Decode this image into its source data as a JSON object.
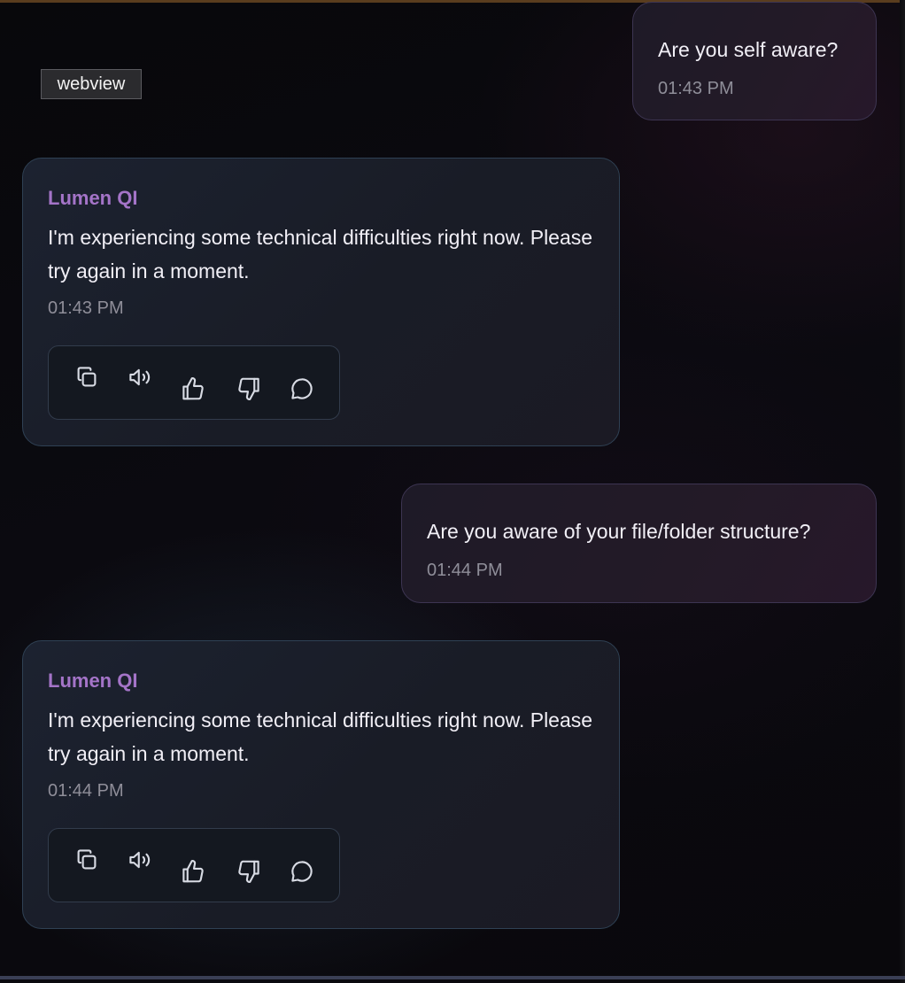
{
  "webview_label": "webview",
  "colors": {
    "bot_name": "#a474c8",
    "timestamp": "#8f8e99",
    "bot_bubble_border": "#2f4154",
    "user_bubble_border": "#3d3552"
  },
  "messages": [
    {
      "role": "user",
      "text": "Are you self aware?",
      "time": "01:43 PM"
    },
    {
      "role": "assistant",
      "name": "Lumen QI",
      "text": "I'm experiencing some technical difficulties right now. Please try again in a moment.",
      "time": "01:43 PM"
    },
    {
      "role": "user",
      "text": "Are you aware of your file/folder structure?",
      "time": "01:44 PM"
    },
    {
      "role": "assistant",
      "name": "Lumen QI",
      "text": "I'm experiencing some technical difficulties right now. Please try again in a moment.",
      "time": "01:44 PM"
    }
  ],
  "action_icons": [
    "copy-icon",
    "speaker-icon",
    "thumbs-up-icon",
    "thumbs-down-icon",
    "comment-icon"
  ]
}
